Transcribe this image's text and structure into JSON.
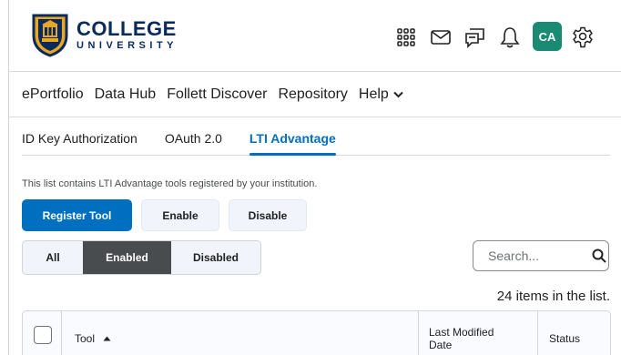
{
  "brand": {
    "name": "COLLEGE",
    "subtitle": "UNIVERSITY"
  },
  "header": {
    "icons": [
      "grid-icon",
      "mail-icon",
      "chat-icon",
      "bell-icon",
      "gear-icon"
    ],
    "avatar_initials": "CA"
  },
  "nav": {
    "items": [
      "ePortfolio",
      "Data Hub",
      "Follett Discover",
      "Repository",
      "Help"
    ]
  },
  "tabs": {
    "items": [
      "ID Key Authorization",
      "OAuth 2.0",
      "LTI Advantage"
    ],
    "active": "LTI Advantage"
  },
  "description": "This list contains LTI Advantage tools registered by your institution.",
  "actions": {
    "register_label": "Register Tool",
    "enable_label": "Enable",
    "disable_label": "Disable"
  },
  "filter": {
    "items": [
      "All",
      "Enabled",
      "Disabled"
    ],
    "active": "Enabled"
  },
  "search": {
    "placeholder": "Search..."
  },
  "count_text": "24 items in the list.",
  "table": {
    "columns": [
      "Tool",
      "Last Modified Date",
      "Status"
    ]
  },
  "colors": {
    "accent": "#006fbf",
    "brand_navy": "#0b2a5c",
    "avatar_bg": "#1b8a72",
    "active_filter_bg": "#494c4e"
  }
}
